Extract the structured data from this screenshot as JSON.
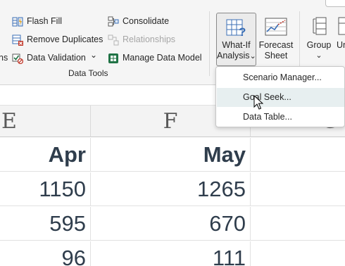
{
  "ribbon": {
    "data_tools": {
      "flash_fill": "Flash Fill",
      "remove_duplicates": "Remove Duplicates",
      "data_validation": "Data Validation",
      "consolidate": "Consolidate",
      "relationships": "Relationships",
      "manage_data_model": "Manage Data Model",
      "group_label": "Data Tools",
      "left_clipped_fragment": "ns",
      "dropdown_caret": "⌄"
    },
    "forecast": {
      "whatif_line1": "What-If",
      "whatif_line2": "Analysis",
      "forecast_line1": "Forecast",
      "forecast_line2": "Sheet"
    },
    "outline": {
      "group": "Group",
      "ungroup_clipped": "Ur"
    }
  },
  "menu": {
    "items": [
      {
        "label": "Scenario Manager..."
      },
      {
        "label": "Goal Seek..."
      },
      {
        "label": "Data Table..."
      }
    ]
  },
  "grid": {
    "columns": [
      "E",
      "F",
      "G"
    ],
    "headers": [
      "Apr",
      "May"
    ],
    "rows": [
      [
        "1150",
        "1265"
      ],
      [
        "595",
        "670"
      ],
      [
        "96",
        "111"
      ]
    ]
  },
  "colors": {
    "ribbon_bg": "#f5f5f5",
    "menu_hover": "#e7eff0",
    "cell_text": "#2f3d4c",
    "accent_green": "#217346"
  }
}
